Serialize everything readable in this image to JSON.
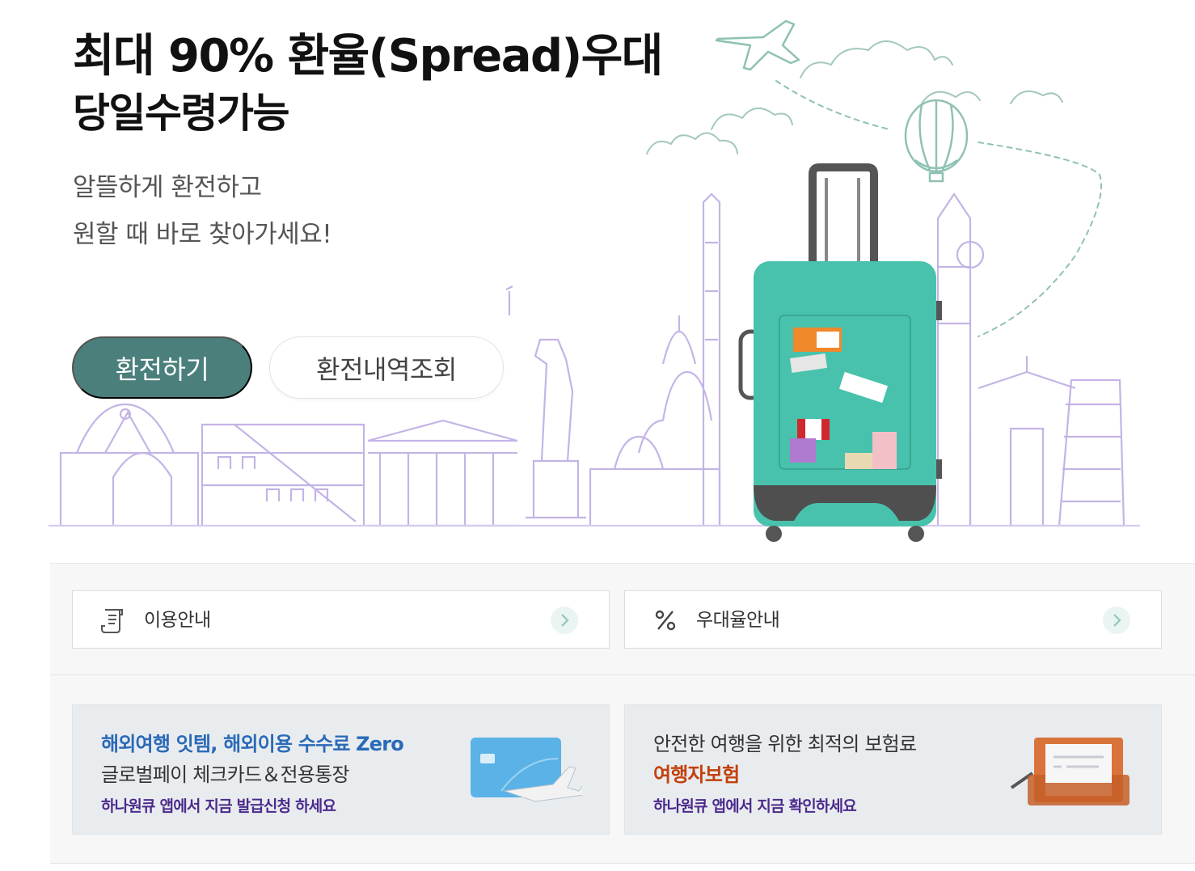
{
  "hero": {
    "title_line1": "최대 90% 환율(Spread)우대",
    "title_line2": "당일수령가능",
    "desc_line1": "알뜰하게 환전하고",
    "desc_line2": "원할 때 바로 찾아가세요!",
    "primary_button": "환전하기",
    "secondary_button": "환전내역조회",
    "button_color": "#4a7f7b"
  },
  "info_links": [
    {
      "label": "이용안내",
      "icon": "document-icon"
    },
    {
      "label": "우대율안내",
      "icon": "percent-icon"
    }
  ],
  "promos": [
    {
      "line1": "해외여행 잇템, 해외이용 수수료 Zero",
      "line2": "글로벌페이 체크카드＆전용통장",
      "line3": "하나원큐 앱에서 지금 발급신청 하세요",
      "image": "card-airplane-icon"
    },
    {
      "line1": "안전한 여행을 위한 최적의 보험료",
      "line2": "여행자보험",
      "line3": "하나원큐 앱에서 지금 확인하세요",
      "image": "suitcase-document-icon"
    }
  ]
}
